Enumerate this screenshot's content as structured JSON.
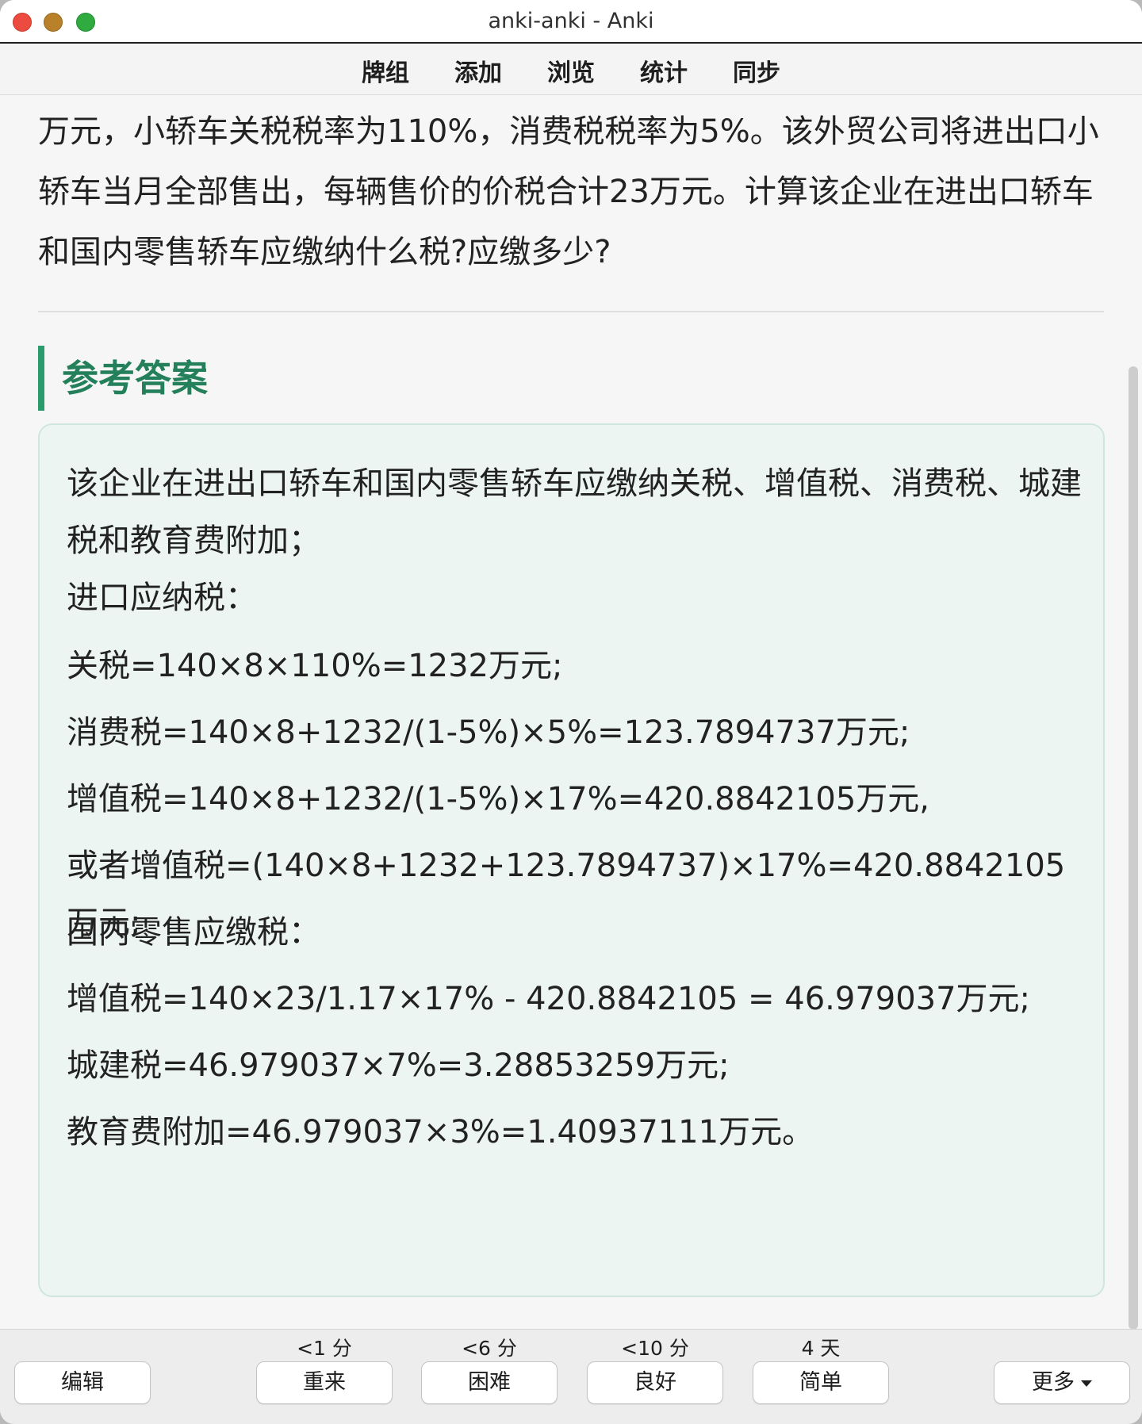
{
  "window": {
    "title": "anki-anki - Anki"
  },
  "toolbar": {
    "items": [
      "牌组",
      "添加",
      "浏览",
      "统计",
      "同步"
    ]
  },
  "card": {
    "question_text": "万元，小轿车关税税率为110%，消费税税率为5%。该外贸公司将进出口小轿车当月全部售出，每辆售价的价税合计23万元。计算该企业在进出口轿车和国内零售轿车应缴纳什么税?应缴多少?",
    "answer_heading": "参考答案",
    "answer_lines": [
      "该企业在进出口轿车和国内零售轿车应缴纳关税、增值税、消费税、城建税和教育费附加；",
      "进口应纳税：",
      "关税=140×8×110%=1232万元;",
      "消费税=140×8+1232/(1-5%)×5%=123.7894737万元;",
      "增值税=140×8+1232/(1-5%)×17%=420.8842105万元,",
      "或者增值税=(140×8+1232+123.7894737)×17%=420.8842105万元;",
      "国内零售应缴税：",
      "增值税=140×23/1.17×17% - 420.8842105 = 46.979037万元;",
      "城建税=46.979037×7%=3.28853259万元;",
      "教育费附加=46.979037×3%=1.40937111万元。"
    ]
  },
  "bottom_bar": {
    "edit_label": "编辑",
    "more_label": "更多",
    "answer_buttons": [
      {
        "interval": "<1 分",
        "label": "重来"
      },
      {
        "interval": "<6 分",
        "label": "困难"
      },
      {
        "interval": "<10 分",
        "label": "良好"
      },
      {
        "interval": "4 天",
        "label": "简单"
      }
    ]
  },
  "colors": {
    "accent": "#2a9b6a",
    "heading": "#23805a",
    "answer_bg": "#edf5f2"
  }
}
